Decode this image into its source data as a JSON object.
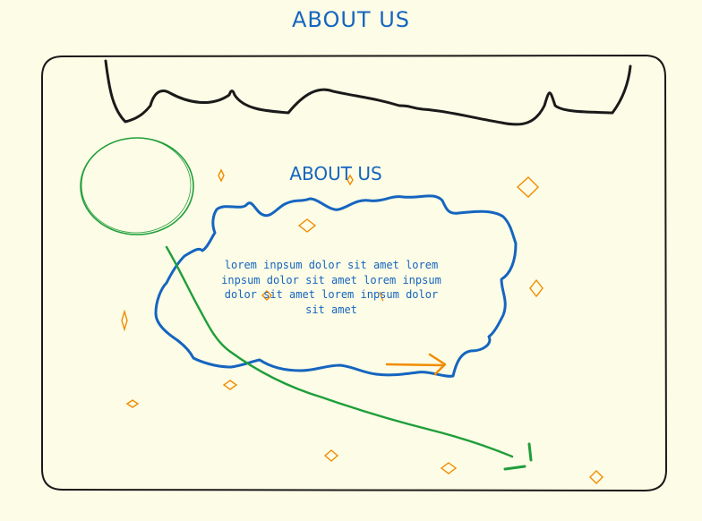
{
  "page": {
    "title": "ABOUT US"
  },
  "card": {
    "heading": "ABOUT US",
    "body": "lorem inpsum dolor sit amet lorem inpsum dolor sit amet lorem inpsum dolor sit amet lorem inpsum dolor sit amet"
  },
  "colors": {
    "background": "#fdfce6",
    "frame": "#1a1a1a",
    "text_blue": "#1565c0",
    "green": "#1e9e3a",
    "orange": "#f08c00"
  }
}
